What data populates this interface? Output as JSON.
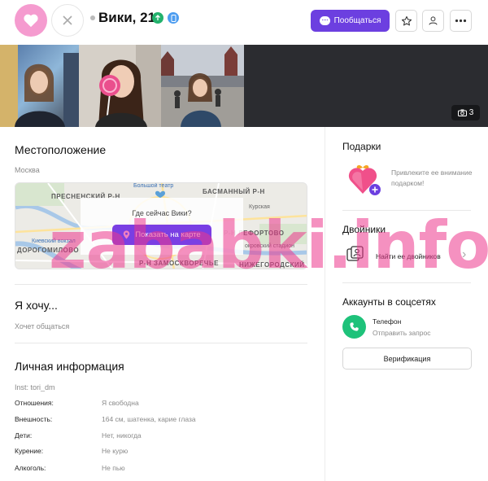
{
  "header": {
    "user_name": "Вики, 21",
    "chat_button_label": "Пообщаться",
    "icons": [
      "heart-icon",
      "close-icon",
      "up-arrow-icon",
      "phone-icon",
      "chat-icon",
      "star-icon",
      "user-icon",
      "more-icon"
    ]
  },
  "photos": {
    "count": "3",
    "camera_icon": "camera-icon"
  },
  "location": {
    "title": "Местоположение",
    "city": "Москва",
    "map": {
      "question": "Где сейчас Вики?",
      "show_button": "Показать на карте",
      "labels": {
        "presnensky": "ПРЕСНЕНСКИЙ Р-Н",
        "basmanny": "БАСМАННЫЙ Р-Н",
        "lefortovo": "Р-Н ЛЕФОРТОВО",
        "dorogomilovo": "ДОРОГОМИЛОВО",
        "zamoskvorechye": "Р-Н ЗАМОСКВОРЕЧЬЕ",
        "nizhegorodsky": "НИЖЕГОРОДСКИЙ",
        "bolshoi": "Большой театр",
        "kurskaya": "Курская",
        "kievsky": "Киевский вокзал",
        "okruzhnoy": "окровский стадион"
      }
    }
  },
  "wants": {
    "title": "Я хочу...",
    "value": "Хочет общаться"
  },
  "personal": {
    "title": "Личная информация",
    "inst": "Inst: tori_dm",
    "rows": [
      {
        "key": "Отношения:",
        "value": "Я свободна"
      },
      {
        "key": "Внешность:",
        "value": "164 см, шатенка, карие глаза"
      },
      {
        "key": "Дети:",
        "value": "Нет, никогда"
      },
      {
        "key": "Курение:",
        "value": "Не курю"
      },
      {
        "key": "Алкоголь:",
        "value": "Не пью"
      }
    ]
  },
  "gifts": {
    "title": "Подарки",
    "text": "Привлеките ее внимание подарком!"
  },
  "twins": {
    "title": "Двойники",
    "link": "Найти ее двойников"
  },
  "social": {
    "title": "Аккаунты в соцсетях",
    "phone_title": "Телефон",
    "phone_action": "Отправить запрос",
    "verify_button": "Верификация"
  },
  "watermark": "zababki.info",
  "colors": {
    "accent": "#6c3fe0",
    "like": "#f59bcf",
    "online": "#23b26d",
    "verified": "#4d9df0",
    "phone": "#1ec27a"
  }
}
